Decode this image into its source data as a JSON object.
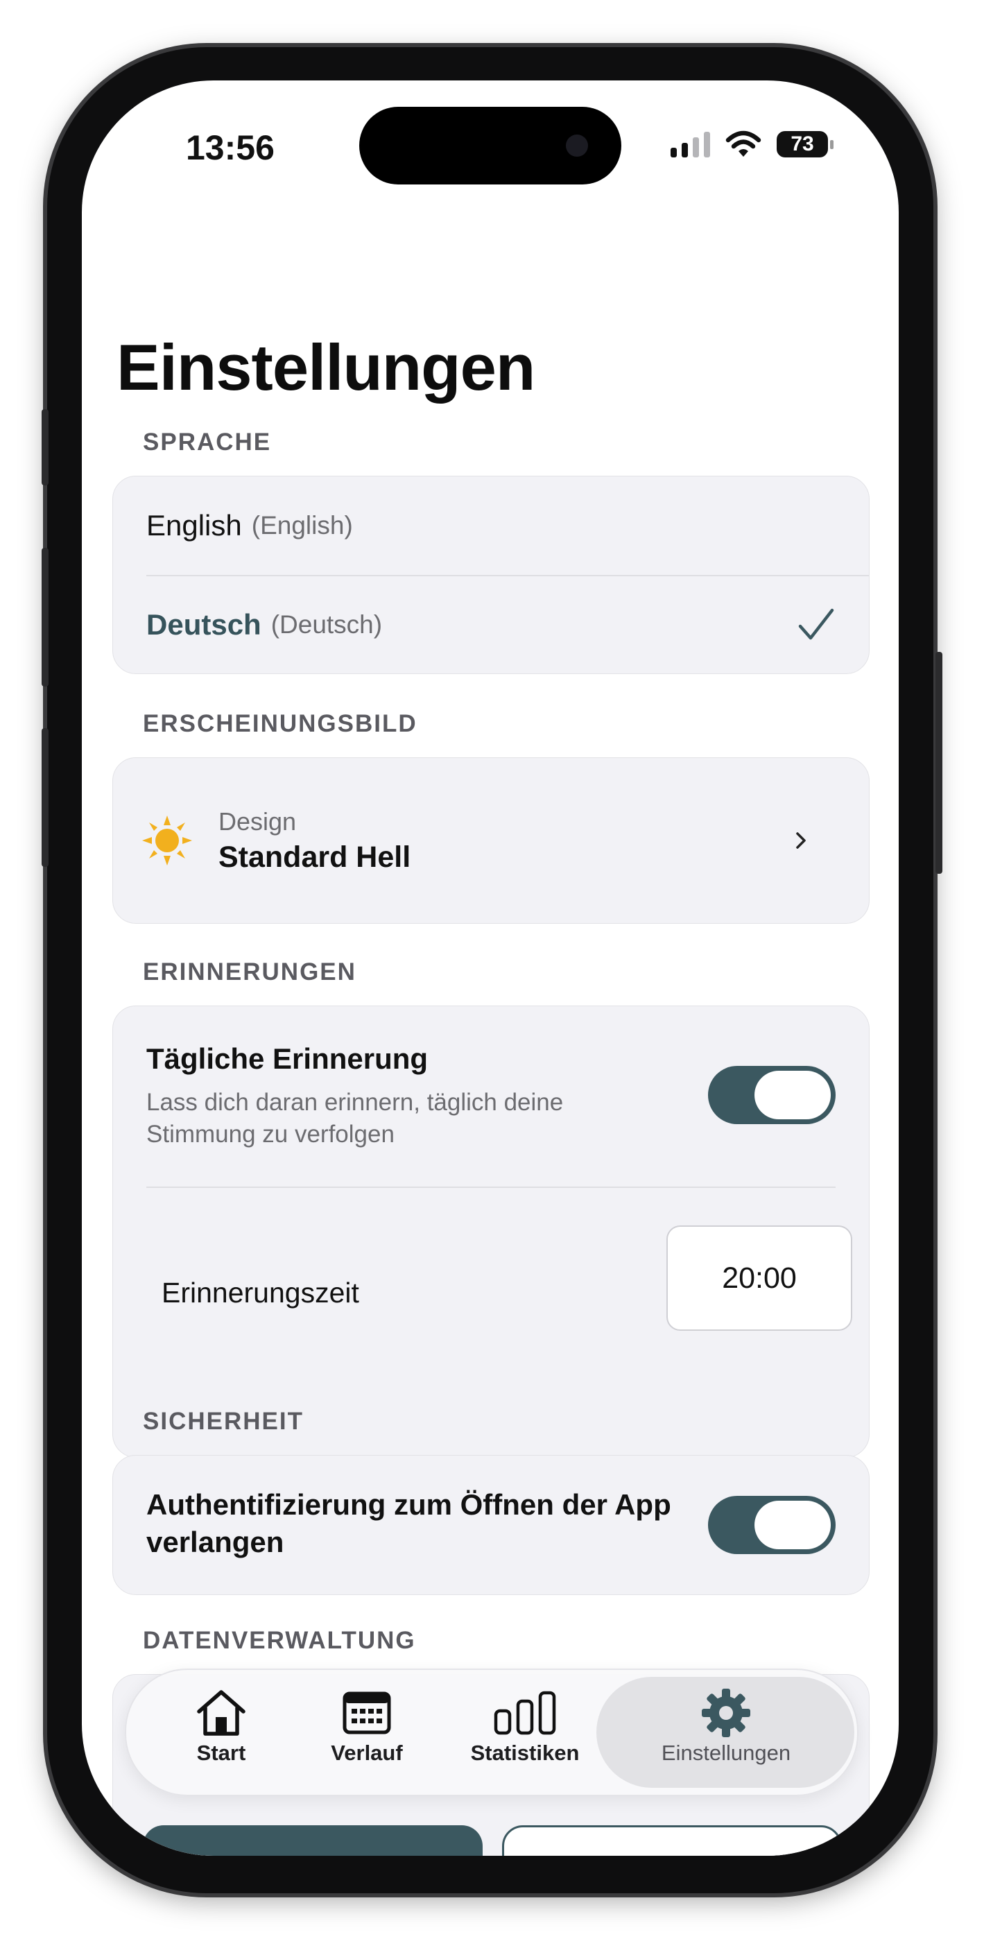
{
  "status": {
    "time": "13:56",
    "battery": "73"
  },
  "page_title": "Einstellungen",
  "language": {
    "section": "SPRACHE",
    "items": [
      {
        "name": "English",
        "native": "(English)",
        "selected": false
      },
      {
        "name": "Deutsch",
        "native": "(Deutsch)",
        "selected": true
      }
    ]
  },
  "appearance": {
    "section": "ERSCHEINUNGSBILD",
    "design_label": "Design",
    "design_value": "Standard Hell",
    "icon": "sun-icon"
  },
  "reminders": {
    "section": "ERINNERUNGEN",
    "daily_title": "Tägliche Erinnerung",
    "daily_subtitle_line1": "Lass dich daran erinnern, täglich deine",
    "daily_subtitle_line2": "Stimmung zu verfolgen",
    "daily_enabled": true,
    "time_label": "Erinnerungszeit",
    "time_value": "20:00"
  },
  "security": {
    "section": "SICHERHEIT",
    "auth_line1": "Authentifizierung zum Öffnen der App",
    "auth_line2": "verlangen",
    "auth_enabled": true
  },
  "data_management": {
    "section": "DATENVERWALTUNG"
  },
  "tabs": [
    {
      "label": "Start",
      "icon": "house-icon",
      "active": false
    },
    {
      "label": "Verlauf",
      "icon": "calendar-icon",
      "active": false
    },
    {
      "label": "Statistiken",
      "icon": "bar-chart-icon",
      "active": false
    },
    {
      "label": "Einstellungen",
      "icon": "gear-icon",
      "active": true
    }
  ],
  "colors": {
    "accent": "#3b5860",
    "selected_text": "#36535b",
    "card_bg": "#f2f2f6",
    "sun": "#f2b01e"
  }
}
